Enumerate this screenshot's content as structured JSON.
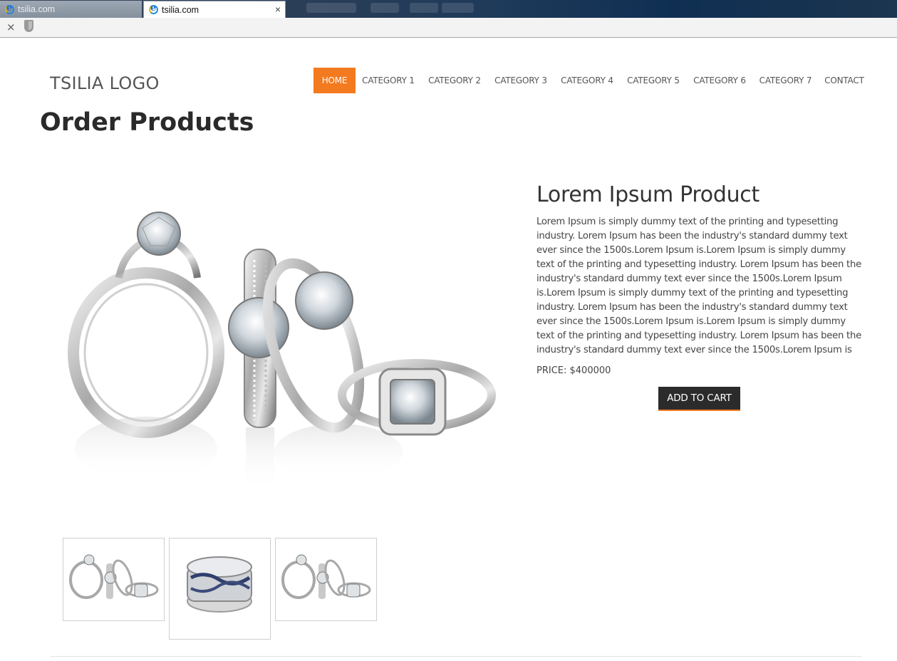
{
  "browser": {
    "tabs": [
      {
        "title": "tsilia.com",
        "active": false
      },
      {
        "title": "tsilia.com",
        "active": true
      }
    ],
    "close_glyph": "×"
  },
  "site": {
    "logo": "TSILIA LOGO",
    "nav": [
      {
        "label": "HOME",
        "active": true
      },
      {
        "label": "CATEGORY 1",
        "active": false
      },
      {
        "label": "CATEGORY 2",
        "active": false
      },
      {
        "label": "CATEGORY 3",
        "active": false
      },
      {
        "label": "CATEGORY 4",
        "active": false
      },
      {
        "label": "CATEGORY 5",
        "active": false
      },
      {
        "label": "CATEGORY 6",
        "active": false
      },
      {
        "label": "CATEGORY 7",
        "active": false
      },
      {
        "label": "CONTACT",
        "active": false
      }
    ],
    "accent_color": "#f47a1f"
  },
  "page": {
    "title": "Order Products"
  },
  "product": {
    "name": "Lorem Ipsum Product",
    "description": "Lorem Ipsum is simply dummy text of the printing and typesetting industry. Lorem Ipsum has been the industry's standard dummy text ever since the 1500s.Lorem Ipsum is.Lorem Ipsum is simply dummy text of the printing and typesetting industry. Lorem Ipsum has been the industry's standard dummy text ever since the 1500s.Lorem Ipsum is.Lorem Ipsum is simply dummy text of the printing and typesetting industry. Lorem Ipsum has been the industry's standard dummy text ever since the 1500s.Lorem Ipsum is.Lorem Ipsum is simply dummy text of the printing and typesetting industry. Lorem Ipsum has been the industry's standard dummy text ever since the 1500s.Lorem Ipsum is",
    "price": "PRICE: $400000",
    "add_to_cart": "ADD TO CART",
    "main_image": "rings-group-image",
    "thumbnails": [
      "rings-group-thumbnail",
      "sapphire-band-thumbnail",
      "rings-group-thumbnail"
    ]
  }
}
